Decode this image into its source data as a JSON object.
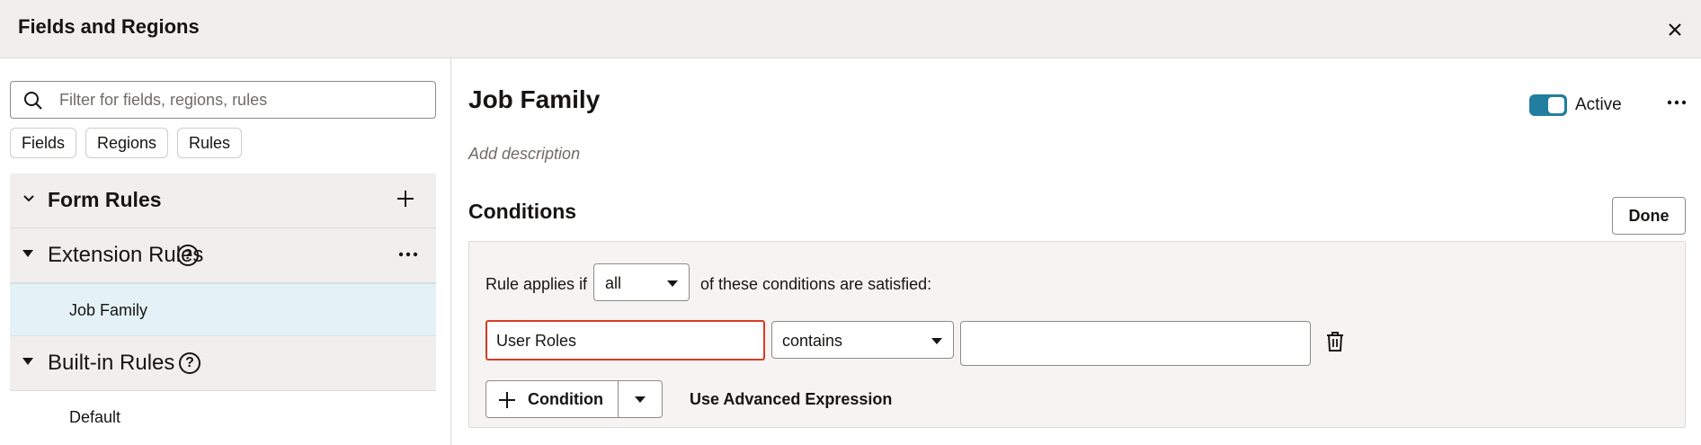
{
  "dialog": {
    "title": "Fields and Regions"
  },
  "sidebar": {
    "search_placeholder": "Filter for fields, regions, rules",
    "filters": [
      {
        "label": "Fields"
      },
      {
        "label": "Regions"
      },
      {
        "label": "Rules"
      }
    ],
    "groups": {
      "form_rules": {
        "label": "Form Rules"
      },
      "extension_rules": {
        "label": "Extension Rules",
        "items": [
          {
            "label": "Job Family",
            "selected": true
          }
        ]
      },
      "builtin_rules": {
        "label": "Built-in Rules",
        "items": [
          {
            "label": "Default"
          }
        ]
      }
    }
  },
  "rule": {
    "title": "Job Family",
    "active_label": "Active",
    "active": true,
    "description_placeholder": "Add description",
    "conditions_title": "Conditions",
    "done_label": "Done",
    "applies_prefix": "Rule applies if",
    "match_mode": "all",
    "applies_suffix": "of these conditions are satisfied:",
    "condition": {
      "field": "User Roles",
      "operator": "contains",
      "value": ""
    },
    "add_condition_label": "Condition",
    "advanced_label": "Use Advanced Expression"
  },
  "colors": {
    "accent": "#227e9e",
    "error_border": "#d63b25",
    "selected_bg": "#e4f1f7"
  }
}
